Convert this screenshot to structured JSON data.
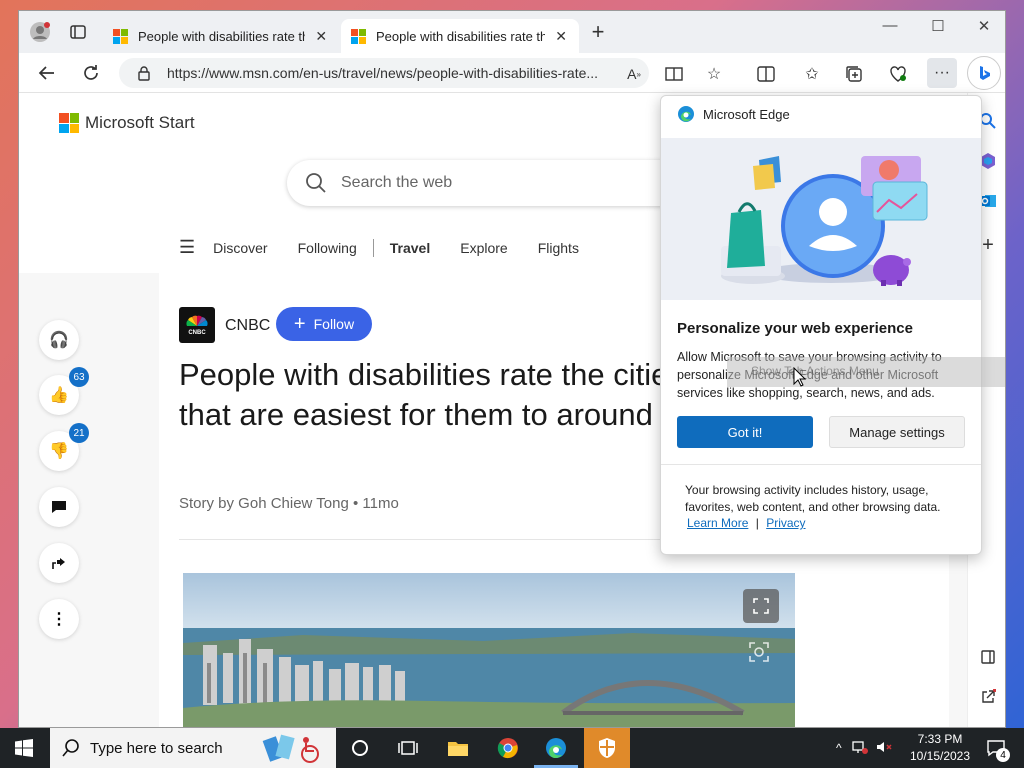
{
  "browser": {
    "tabs": [
      {
        "title": "People with disabilities rate the t",
        "active": false
      },
      {
        "title": "People with disabilities rate the t",
        "active": true
      }
    ],
    "url": "https://www.msn.com/en-us/travel/news/people-with-disabilities-rate..."
  },
  "page": {
    "brand": "Microsoft Start",
    "search_placeholder": "Search the web",
    "nav": [
      "Discover",
      "Following",
      "Travel",
      "Explore",
      "Flights"
    ],
    "active_nav": "Travel",
    "rail": {
      "likes": "63",
      "dislikes": "21"
    },
    "source": "CNBC",
    "follow_label": "Follow",
    "headline": "People with disabilities rate the cities that are easiest for them to around",
    "byline": "Story by Goh Chiew Tong • 11mo"
  },
  "popup": {
    "header": "Microsoft Edge",
    "title": "Personalize your web experience",
    "body": "Allow Microsoft to save your browsing activity to personalize Microsoft Edge and other Microsoft services like shopping, search, news, and ads.",
    "primary": "Got it!",
    "secondary": "Manage settings",
    "note": "Your browsing activity includes history, usage, favorites, web content, and other browsing data.",
    "learn_more": "Learn More",
    "separator": "|",
    "privacy": "Privacy"
  },
  "tooltip": "Show Tab Actions Menu",
  "taskbar": {
    "search_placeholder": "Type here to search",
    "time": "7:33 PM",
    "date": "10/15/2023",
    "notifications": "4"
  },
  "colors": {
    "accent": "#0f6cbd",
    "follow": "#3a63e6",
    "badge": "#1470c8"
  }
}
